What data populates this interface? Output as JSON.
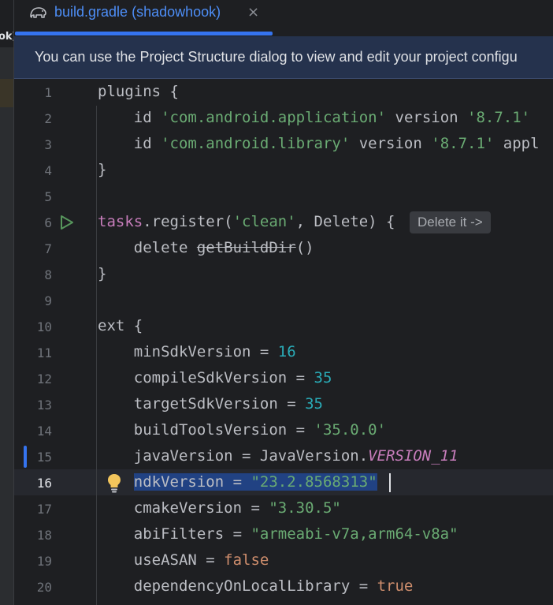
{
  "left_panel": {
    "label": "ok]"
  },
  "tab": {
    "title": "build.gradle (shadowhook)",
    "close": "×",
    "icon": "gradle-elephant-icon"
  },
  "banner": {
    "text": "You can use the Project Structure dialog to view and edit your project configu"
  },
  "editor": {
    "inlay_hint": "Delete it ->",
    "current_line": 16,
    "line_numbers": [
      "1",
      "2",
      "3",
      "4",
      "5",
      "6",
      "7",
      "8",
      "9",
      "10",
      "11",
      "12",
      "13",
      "14",
      "15",
      "16",
      "17",
      "18",
      "19",
      "20"
    ],
    "lines": {
      "l1": {
        "a": "plugins {"
      },
      "l2": {
        "a": "    id ",
        "b": "'com.android.application'",
        "c": " version ",
        "d": "'8.7.1'"
      },
      "l3": {
        "a": "    id ",
        "b": "'com.android.library'",
        "c": " version ",
        "d": "'8.7.1'",
        "e": " appl"
      },
      "l4": {
        "a": "}"
      },
      "l6": {
        "a": "tasks",
        "b": ".register(",
        "c": "'clean'",
        "d": ", Delete) {"
      },
      "l7": {
        "a": "    delete ",
        "b": "getBuildDir",
        "c": "()"
      },
      "l8": {
        "a": "}"
      },
      "l10": {
        "a": "ext {"
      },
      "l11": {
        "a": "    minSdkVersion = ",
        "b": "16"
      },
      "l12": {
        "a": "    compileSdkVersion = ",
        "b": "35"
      },
      "l13": {
        "a": "    targetSdkVersion = ",
        "b": "35"
      },
      "l14": {
        "a": "    buildToolsVersion = ",
        "b": "'35.0.0'"
      },
      "l15": {
        "a": "    javaVersion = JavaVersion.",
        "b": "VERSION_11"
      },
      "l16": {
        "a": "    ",
        "b": "ndkVersion = ",
        "c": "\"23.2.8568313\""
      },
      "l17": {
        "a": "    cmakeVersion = ",
        "b": "\"3.30.5\""
      },
      "l18": {
        "a": "    abiFilters = ",
        "b": "\"armeabi-v7a,arm64-v8a\""
      },
      "l19": {
        "a": "    useASAN = ",
        "b": "false"
      },
      "l20": {
        "a": "    dependencyOnLocalLibrary = ",
        "b": "true"
      }
    }
  },
  "colors": {
    "background": "#1e1f22",
    "keyword": "#cf8e6d",
    "string": "#6aab73",
    "number": "#2aacb8",
    "field": "#c77dbb",
    "accent": "#3574f0",
    "selection": "#214283"
  }
}
